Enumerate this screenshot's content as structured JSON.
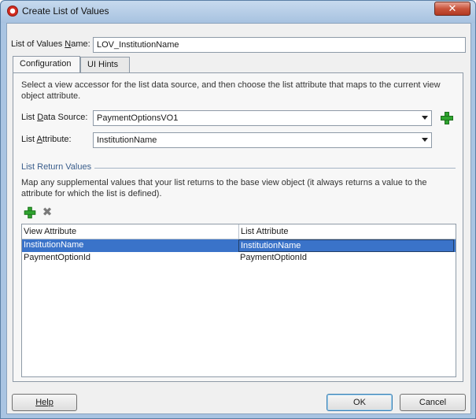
{
  "window": {
    "title": "Create List of Values",
    "close_label": "✕"
  },
  "lov_name": {
    "label_pre": "List of Values ",
    "label_u": "N",
    "label_post": "ame:",
    "value": "LOV_InstitutionName"
  },
  "tabs": [
    {
      "label": "Configuration",
      "active": true
    },
    {
      "label": "UI Hints",
      "active": false
    }
  ],
  "description": "Select a view accessor for the list data source, and then choose the list attribute that maps to the current view object attribute.",
  "list_data_source": {
    "label_pre": "List ",
    "label_u": "D",
    "label_post": "ata Source:",
    "value": "PaymentOptionsVO1"
  },
  "list_attribute": {
    "label_pre": "List ",
    "label_u": "A",
    "label_post": "ttribute:",
    "value": "InstitutionName"
  },
  "return_values": {
    "heading": "List Return Values",
    "description": "Map any supplemental values that your list returns to the base view object (it always returns a value to the attribute for which the list is defined).",
    "columns": [
      "View Attribute",
      "List Attribute"
    ],
    "rows": [
      {
        "view_attribute": "InstitutionName",
        "list_attribute": "InstitutionName",
        "selected": true
      },
      {
        "view_attribute": "PaymentOptionId",
        "list_attribute": "PaymentOptionId",
        "selected": false
      }
    ]
  },
  "buttons": {
    "help": "Help",
    "ok": "OK",
    "cancel": "Cancel"
  },
  "colors": {
    "accent": "#3a73c9",
    "add_icon": "#2fa52f",
    "section_heading": "#3a5e8c"
  },
  "icons": {
    "add": "plus-icon",
    "remove": "x-icon",
    "window": "oracle-logo-icon"
  }
}
